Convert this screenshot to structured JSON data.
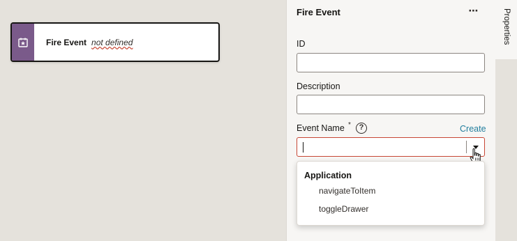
{
  "canvas": {
    "node": {
      "title": "Fire Event",
      "status": "not defined",
      "icon": "calendar-event-icon",
      "strip_color": "#7a5a8a"
    }
  },
  "panel": {
    "title": "Fire Event",
    "more_label": "⋯",
    "fields": {
      "id": {
        "label": "ID",
        "value": ""
      },
      "description": {
        "label": "Description",
        "value": ""
      },
      "event_name": {
        "label": "Event Name",
        "required_mark": "*",
        "help_icon": "?",
        "create_link": "Create",
        "value": ""
      }
    },
    "dropdown": {
      "group": "Application",
      "options": [
        "navigateToItem",
        "toggleDrawer"
      ]
    }
  },
  "rail": {
    "tab": "Properties"
  },
  "colors": {
    "error_border": "#c74634",
    "link": "#227e9e"
  }
}
